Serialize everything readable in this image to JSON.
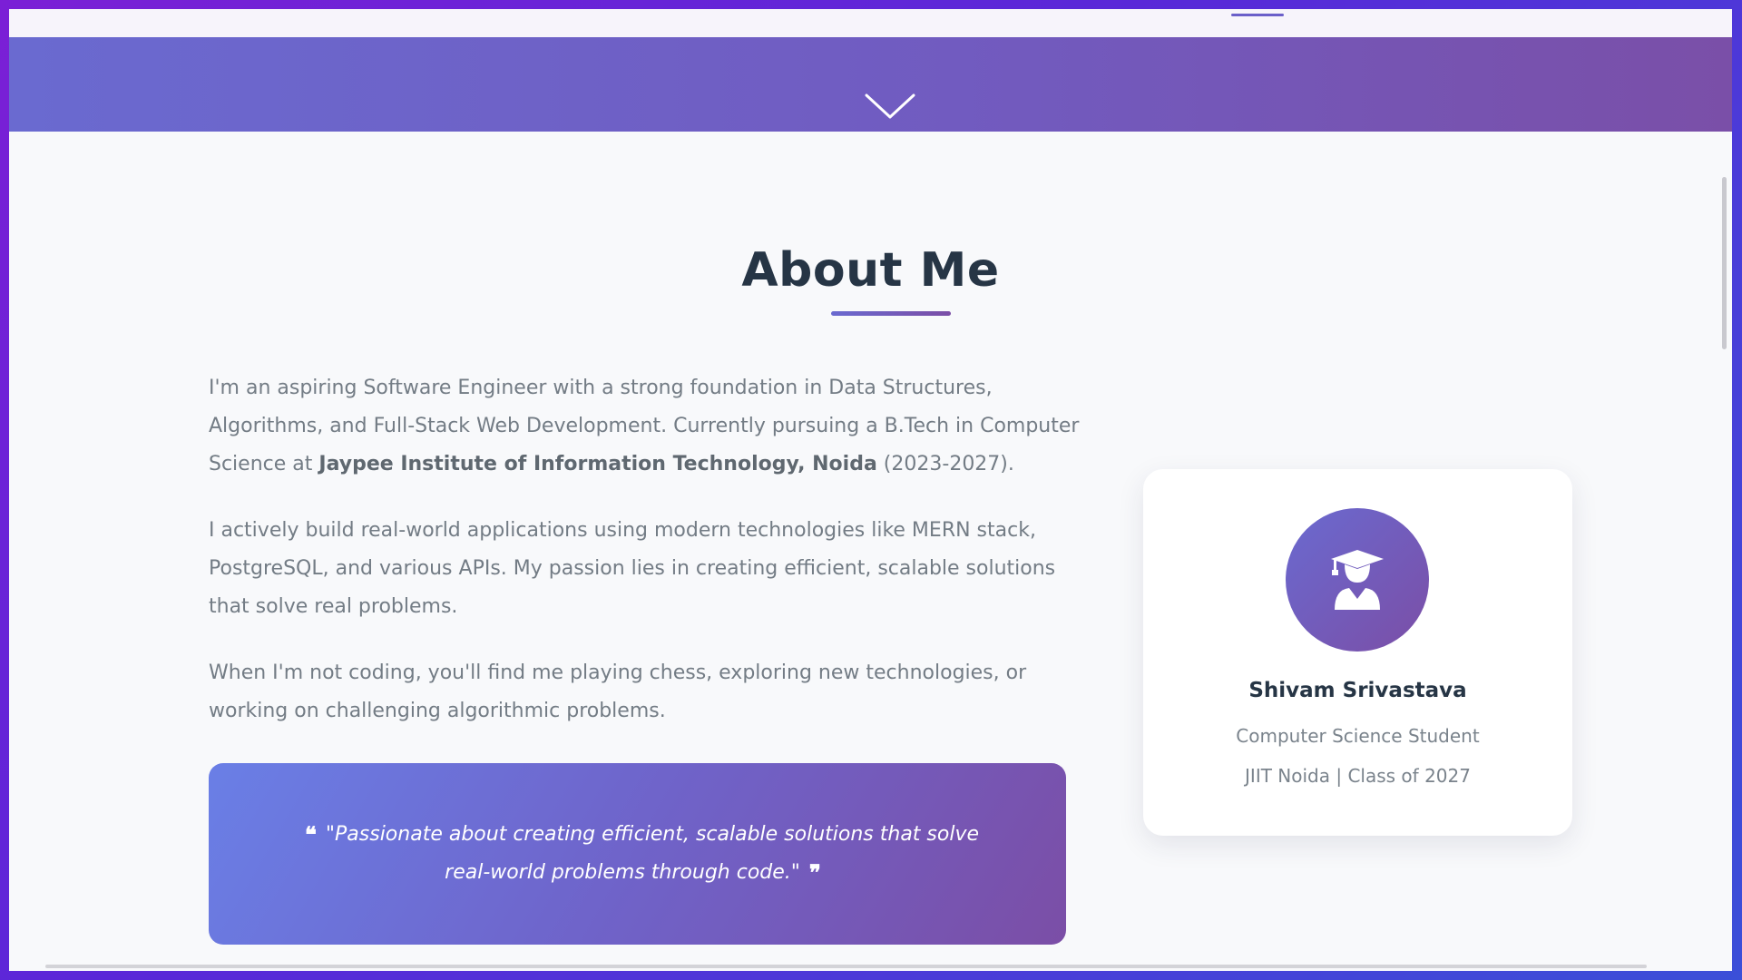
{
  "about": {
    "title": "About Me",
    "paragraph1_before": "I'm an aspiring Software Engineer with a strong foundation in Data Structures, Algorithms, and Full-Stack Web Development. Currently pursuing a B.Tech in Computer Science at ",
    "paragraph1_strong": "Jaypee Institute of Information Technology, Noida",
    "paragraph1_after": " (2023-2027).",
    "paragraph2": "I actively build real-world applications using modern technologies like MERN stack, PostgreSQL, and various APIs. My passion lies in creating efficient, scalable solutions that solve real problems.",
    "paragraph3": "When I'm not coding, you'll find me playing chess, exploring new technologies, or working on challenging algorithmic problems.",
    "quote_open": "❝",
    "quote": "\"Passionate about creating efficient, scalable solutions that solve real-world problems through code.\"",
    "quote_close": "❞"
  },
  "profile": {
    "name": "Shivam Srivastava",
    "role": "Computer Science Student",
    "school": "JIIT Noida | Class of 2027",
    "avatar_icon": "graduate-icon"
  },
  "icons": {
    "scroll": "chevron-down-icon"
  },
  "colors": {
    "accent_start": "#6a6ad0",
    "accent_end": "#7b4ea6",
    "heading": "#263545",
    "body_text": "#737c85"
  }
}
